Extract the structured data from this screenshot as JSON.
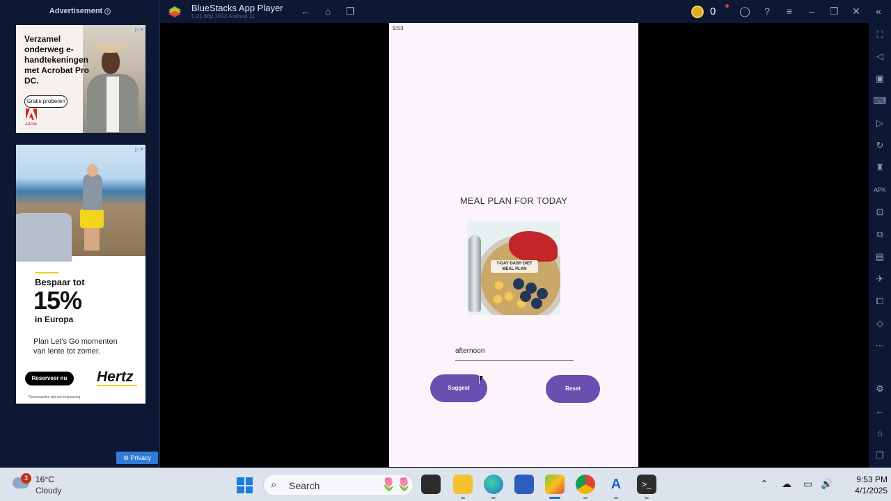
{
  "ad_panel": {
    "title": "Advertisement",
    "ad1": {
      "headline": "Verzamel onderweg e-handtekeningen met Acrobat Pro DC.",
      "button": "Gratis proberen",
      "brand": "Adobe"
    },
    "ad2": {
      "line1": "Bespaar tot",
      "big": "15%",
      "line2": "in Europa",
      "body": "Plan Let's Go momenten van lente tot zomer.",
      "button": "Reserveer nu",
      "brand": "Hertz",
      "fine": "*Voorwaarden zijn van toepassing"
    },
    "privacy": "Privacy"
  },
  "titlebar": {
    "title": "BlueStacks App Player",
    "version": "5.21.660.1042  Android 11",
    "coins": "0"
  },
  "phone": {
    "time": "9:53",
    "heading": "MEAL PLAN FOR TODAY",
    "image_label": "7-DAY DASH DIET MEAL PLAN",
    "input_value": "afternoon",
    "suggest_label": "Suggest",
    "reset_label": "Reset"
  },
  "taskbar": {
    "weather_badge": "3",
    "temp": "16°C",
    "condition": "Cloudy",
    "search_label": "Search",
    "time": "9:53 PM",
    "date": "4/1/2025"
  },
  "colors": {
    "bluestacks_bg": "#0c1834",
    "app_button": "#6a4fb0",
    "phone_bg": "#fbf4fb"
  }
}
